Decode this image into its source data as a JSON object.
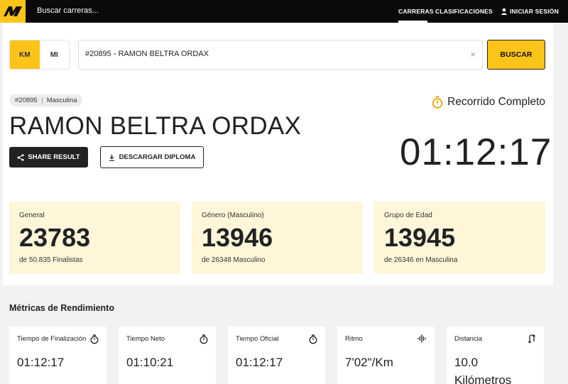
{
  "nav": {
    "search_label": "Buscar carreras...",
    "carreras": "CARRERAS",
    "clasificaciones": "CLASIFICACIONES",
    "login": "INICIAR SESIÓN"
  },
  "units": {
    "km": "KM",
    "mi": "MI",
    "active": "KM"
  },
  "search": {
    "value": "#20895 - RAMON BELTRA ORDAX",
    "clear": "×",
    "button": "BUSCAR"
  },
  "runner": {
    "bib": "#20895",
    "category": "Masculina",
    "name": "RAMON BELTRA ORDAX",
    "status": "Recorrido Completo",
    "finish_time": "01:12:17"
  },
  "actions": {
    "share": "SHARE RESULT",
    "diploma": "DESCARGAR DIPLOMA"
  },
  "rankings": [
    {
      "label": "General",
      "value": "23783",
      "sub": "de 50.835 Finalistas"
    },
    {
      "label": "Género (Masculino)",
      "value": "13946",
      "sub": "de 26348 Masculino"
    },
    {
      "label": "Grupo de Edad",
      "value": "13945",
      "sub": "de 26346 en Masculina"
    }
  ],
  "metrics": {
    "title": "Métricas de Rendimiento",
    "items": [
      {
        "label": "Tiempo de Finalización",
        "value": "01:12:17",
        "icon": "stopwatch-icon"
      },
      {
        "label": "Tiempo Neto",
        "value": "01:10:21",
        "icon": "stopwatch-icon"
      },
      {
        "label": "Tiempo Oficial",
        "value": "01:12:17",
        "icon": "stopwatch-icon"
      },
      {
        "label": "Ritmo",
        "value": "7'02\"/Km",
        "icon": "pace-wave-icon"
      },
      {
        "label": "Distancia",
        "value": "10.0 Kilómetros",
        "icon": "route-icon"
      }
    ]
  },
  "colors": {
    "accent": "#fcc419",
    "dark": "#0a0a0a",
    "card_bg": "#fff6d9"
  }
}
